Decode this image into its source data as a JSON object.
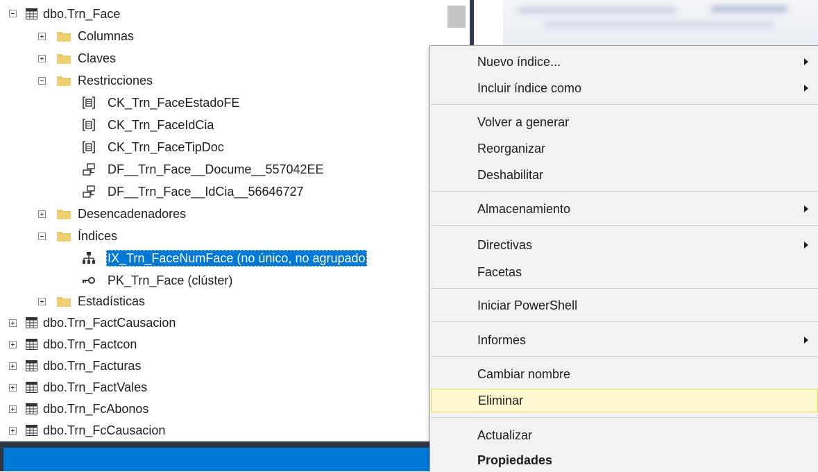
{
  "tree": {
    "root_table": "dbo.Trn_Face",
    "folders": {
      "columns": "Columnas",
      "keys": "Claves",
      "constraints": "Restricciones",
      "triggers": "Desencadenadores",
      "indexes": "Índices",
      "statistics": "Estadísticas"
    },
    "constraints": [
      "CK_Trn_FaceEstadoFE",
      "CK_Trn_FaceIdCia",
      "CK_Trn_FaceTipDoc"
    ],
    "defaults": [
      "DF__Trn_Face__Docume__557042EE",
      "DF__Trn_Face__IdCia__56646727"
    ],
    "indexes": [
      "IX_Trn_FaceNumFace (no único, no agrupado",
      "PK_Trn_Face (clúster)"
    ],
    "other_tables": [
      "dbo.Trn_FactCausacion",
      "dbo.Trn_Factcon",
      "dbo.Trn_Facturas",
      "dbo.Trn_FactVales",
      "dbo.Trn_FcAbonos",
      "dbo.Trn_FcCausacion"
    ],
    "selected_item": "IX_Trn_FaceNumFace (no único, no agrupado"
  },
  "context_menu": {
    "items": [
      {
        "label": "Nuevo índice...",
        "submenu": true
      },
      {
        "label": "Incluir índice como",
        "submenu": true
      },
      {
        "label": "Volver a generar"
      },
      {
        "label": "Reorganizar"
      },
      {
        "label": "Deshabilitar"
      },
      {
        "label": "Almacenamiento",
        "submenu": true
      },
      {
        "label": "Directivas",
        "submenu": true
      },
      {
        "label": "Facetas"
      },
      {
        "label": "Iniciar PowerShell"
      },
      {
        "label": "Informes",
        "submenu": true
      },
      {
        "label": "Cambiar nombre"
      },
      {
        "label": "Eliminar",
        "highlighted": true
      },
      {
        "label": "Actualizar"
      },
      {
        "label": "Propiedades",
        "bold": true
      }
    ]
  },
  "colors": {
    "selection": "#0078d7",
    "menu_background": "#f2f2f2",
    "menu_highlight": "#fcf8d0",
    "folder": "#e8c66a",
    "statusbar": "#0078d7"
  },
  "icons": {
    "table": "table-icon",
    "folder": "folder-icon",
    "check_constraint": "check-constraint-icon",
    "default_constraint": "default-constraint-icon",
    "index": "index-icon",
    "primary_key": "key-icon",
    "submenu": "submenu-arrow-icon"
  }
}
